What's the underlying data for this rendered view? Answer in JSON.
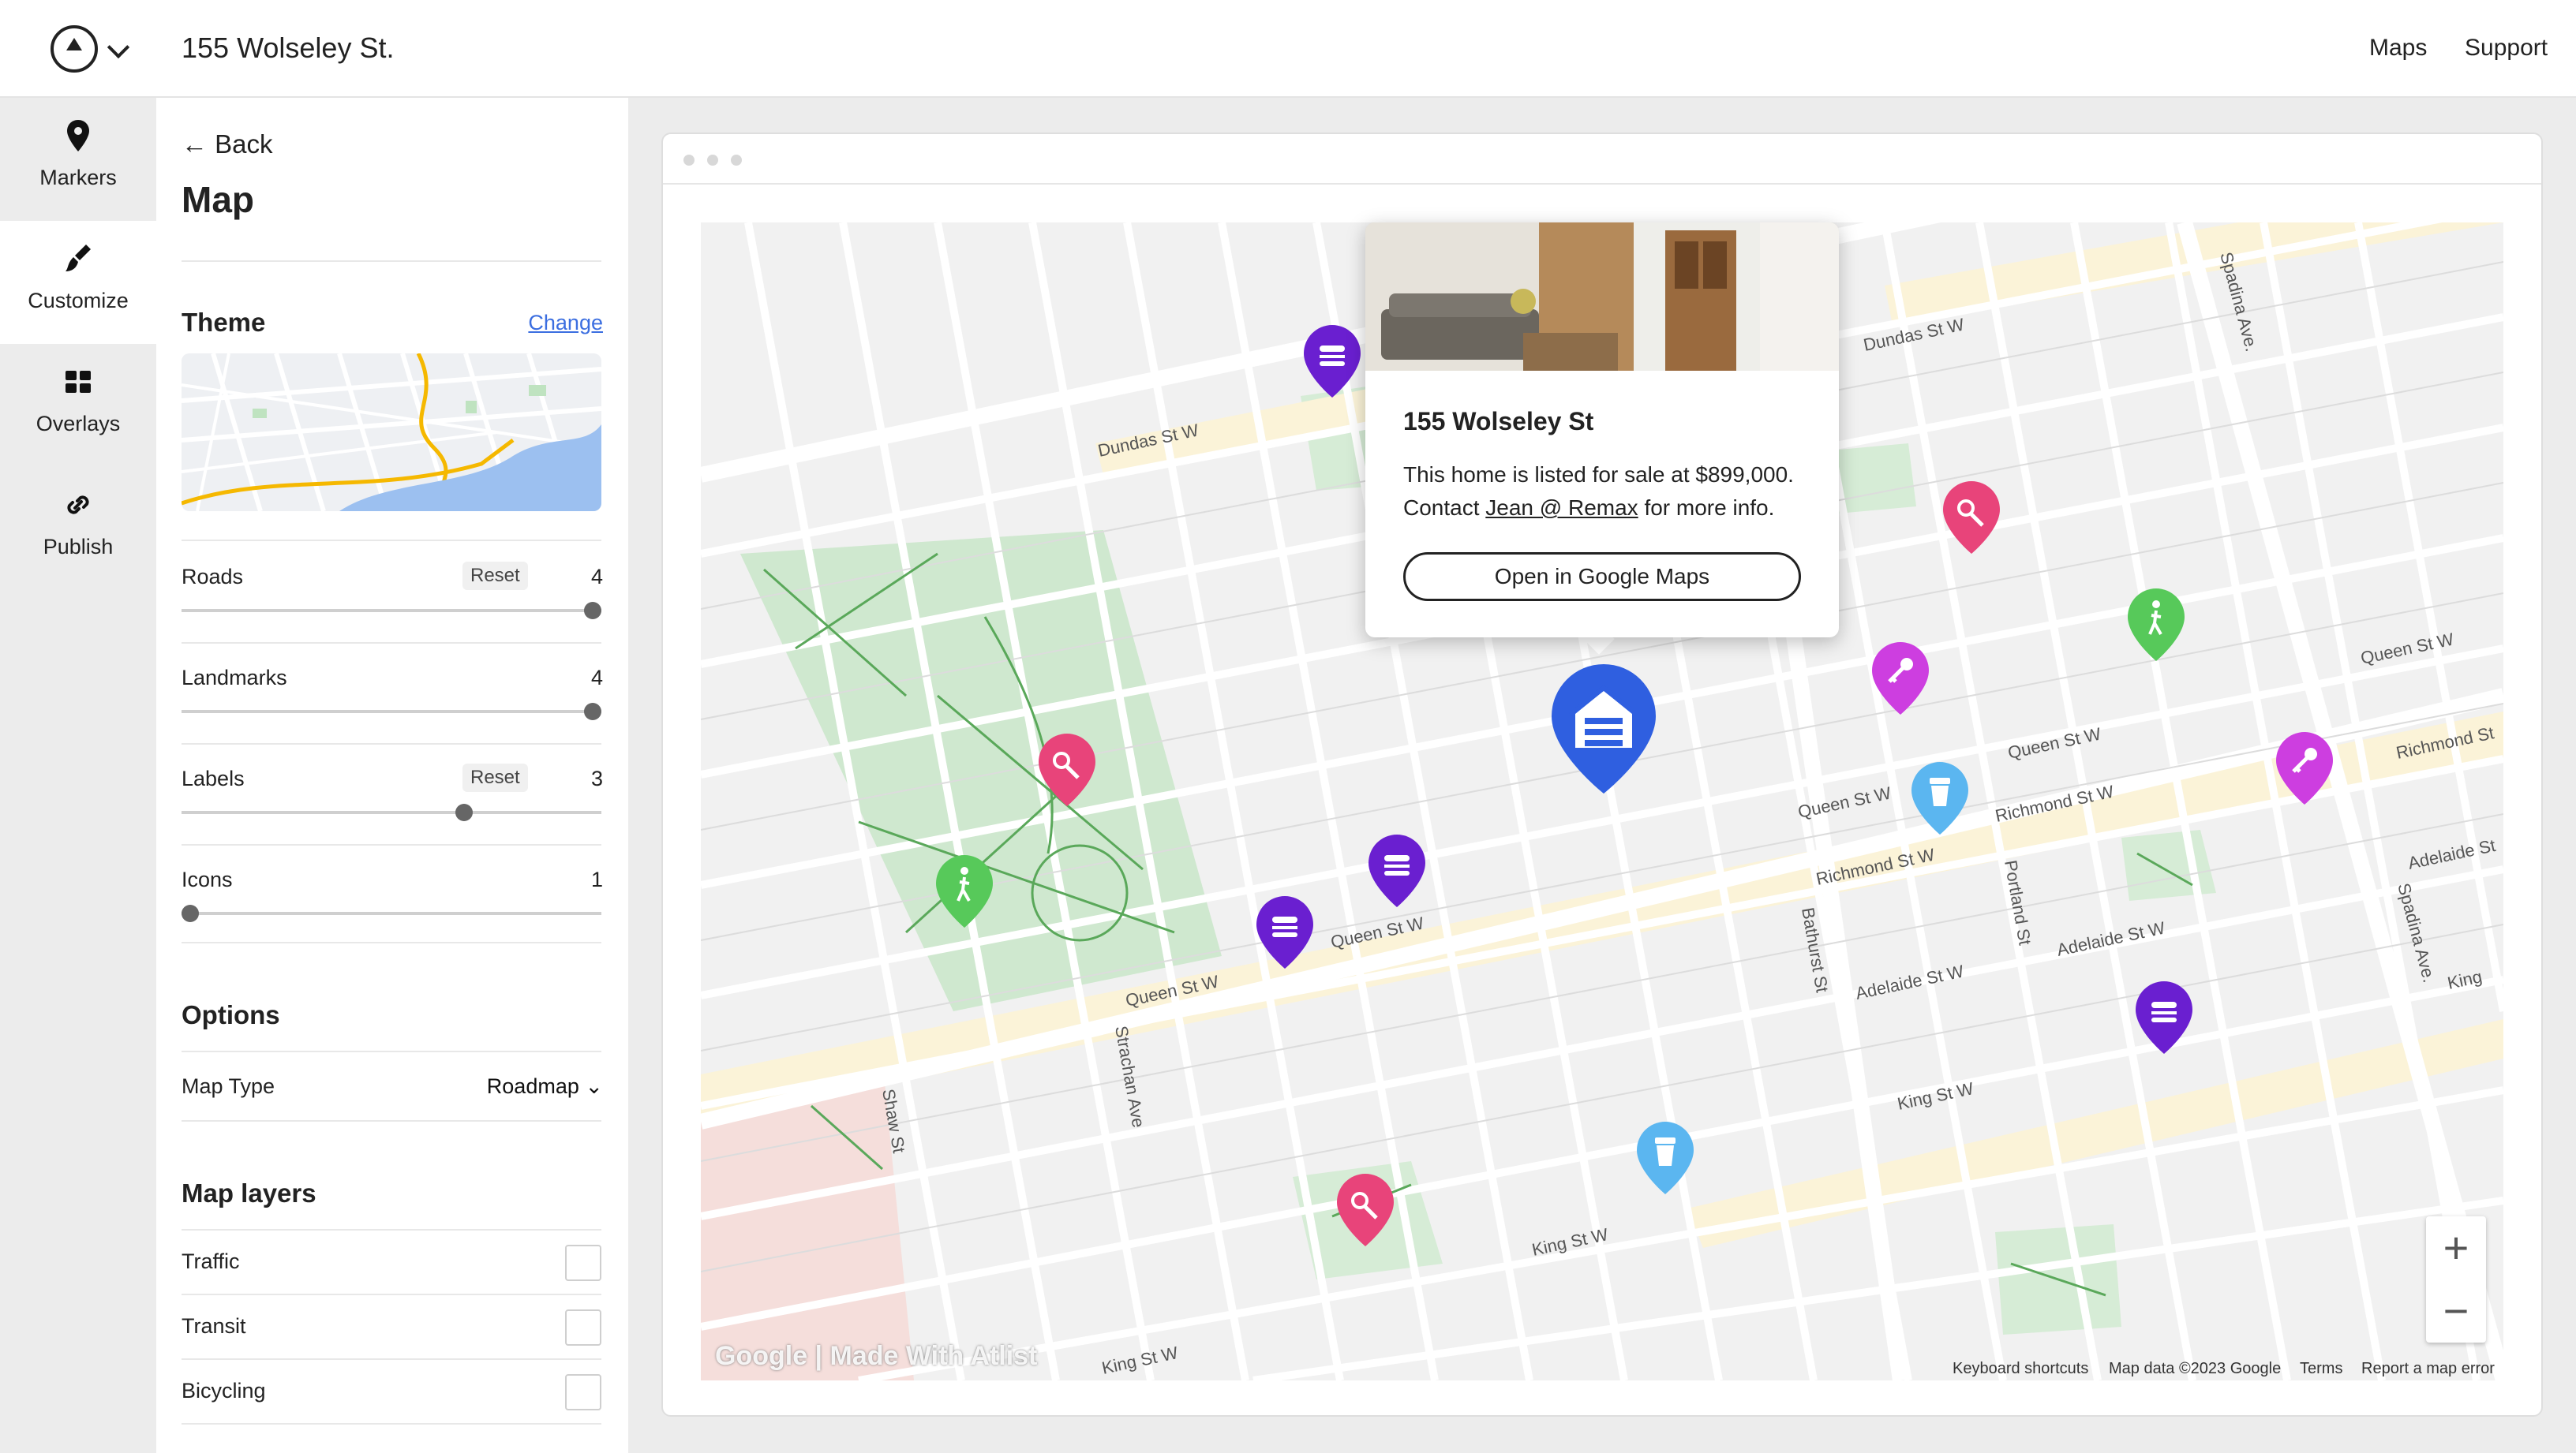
{
  "header": {
    "doc_title": "155 Wolseley St.",
    "nav": [
      "Maps",
      "Support"
    ]
  },
  "rail": {
    "items": [
      {
        "label": "Markers",
        "icon": "map-pin-icon"
      },
      {
        "label": "Customize",
        "icon": "paintbrush-icon",
        "active": true
      },
      {
        "label": "Overlays",
        "icon": "grid-icon"
      },
      {
        "label": "Publish",
        "icon": "link-icon"
      }
    ]
  },
  "panel": {
    "back": "Back",
    "title": "Map",
    "theme": {
      "label": "Theme",
      "change": "Change"
    },
    "sliders": [
      {
        "label": "Roads",
        "value": "4",
        "reset": "Reset",
        "fraction": 1.0
      },
      {
        "label": "Landmarks",
        "value": "4",
        "reset": "",
        "fraction": 1.0
      },
      {
        "label": "Labels",
        "value": "3",
        "reset": "Reset",
        "fraction": 0.68
      },
      {
        "label": "Icons",
        "value": "1",
        "reset": "",
        "fraction": 0.0
      }
    ],
    "options": {
      "label": "Options",
      "map_type_label": "Map Type",
      "map_type_value": "Roadmap"
    },
    "layers": {
      "label": "Map layers",
      "items": [
        "Traffic",
        "Transit",
        "Bicycling"
      ]
    }
  },
  "popup": {
    "title": "155 Wolseley St",
    "line1": "This home is listed for sale at $899,000.",
    "line2_prefix": "Contact ",
    "line2_link": "Jean @ Remax",
    "line2_suffix": " for more info.",
    "button": "Open in Google Maps"
  },
  "map": {
    "zoom_in": "+",
    "zoom_out": "−",
    "brand": "Google | Made With Atlist",
    "footer": [
      "Keyboard shortcuts",
      "Map data ©2023 Google",
      "Terms",
      "Report a map error"
    ],
    "street_labels": [
      "Dundas St W",
      "Dundas St W",
      "Queen St W",
      "Queen St W",
      "Queen St W",
      "Queen St W",
      "Richmond St W",
      "Richmond St W",
      "Adelaide St W",
      "Adelaide St W",
      "King St W",
      "King St W",
      "King St W",
      "Bathurst St",
      "Portland St",
      "Spadina Ave.",
      "Spadina Ave.",
      "Strachan Ave",
      "Shaw St",
      "Richmond St",
      "Adelaide St",
      "King",
      "Queen St W"
    ],
    "colors": {
      "burger": "#6a1fd0",
      "tennis": "#e8447a",
      "walk": "#57c95a",
      "key": "#cd3ee0",
      "drink": "#5bb6f0",
      "home": "#2f5fe0"
    }
  }
}
